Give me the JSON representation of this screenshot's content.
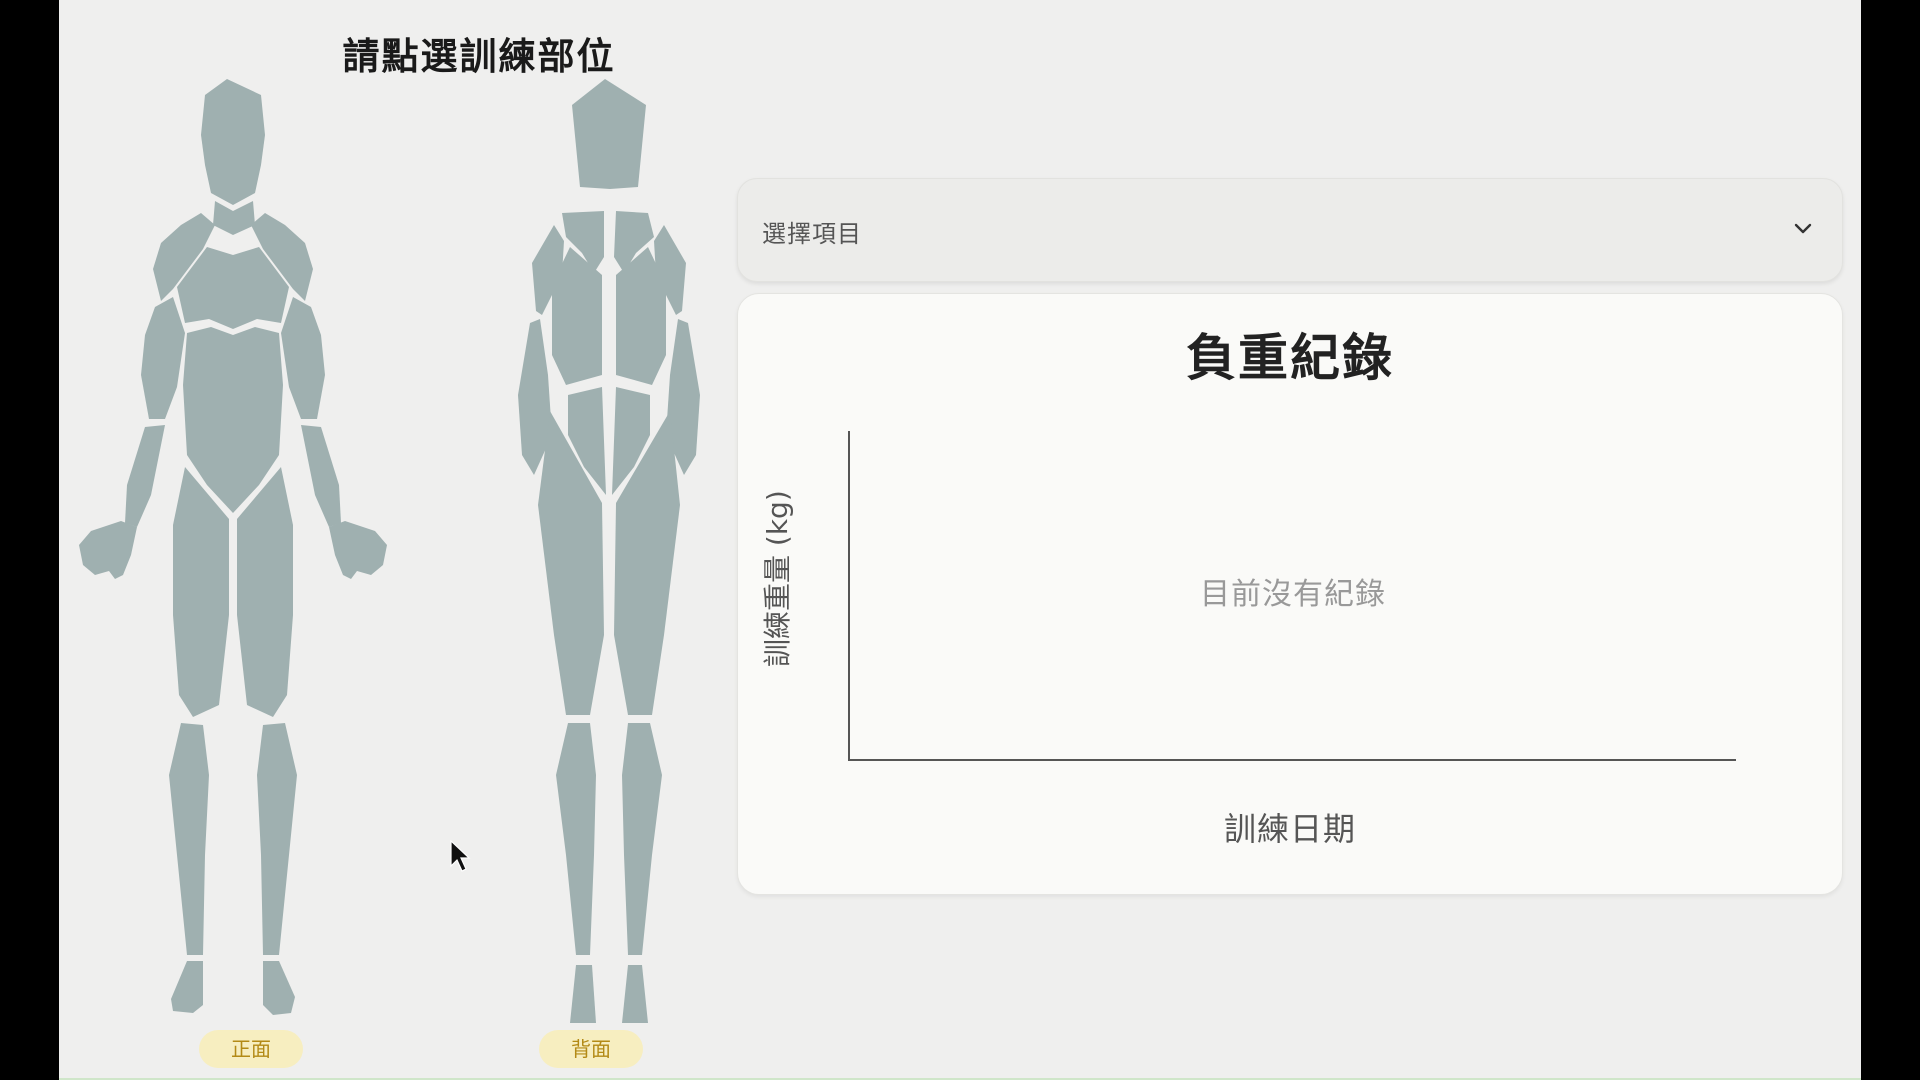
{
  "picker": {
    "title": "請點選訓練部位",
    "front_label": "正面",
    "back_label": "背面"
  },
  "selector": {
    "placeholder": "選擇項目",
    "icon": "chevron-down-icon"
  },
  "chart": {
    "title": "負重紀錄",
    "ylabel": "訓練重量 (kg)",
    "xlabel": "訓練日期",
    "empty_message": "目前沒有紀錄"
  },
  "chart_data": {
    "type": "line",
    "title": "負重紀錄",
    "xlabel": "訓練日期",
    "ylabel": "訓練重量 (kg)",
    "series": [],
    "grid": false
  },
  "colors": {
    "muscle": "#9fb0b0",
    "badge_bg": "#f7eec0",
    "badge_text": "#b38a16",
    "page_bg": "#efefee"
  }
}
